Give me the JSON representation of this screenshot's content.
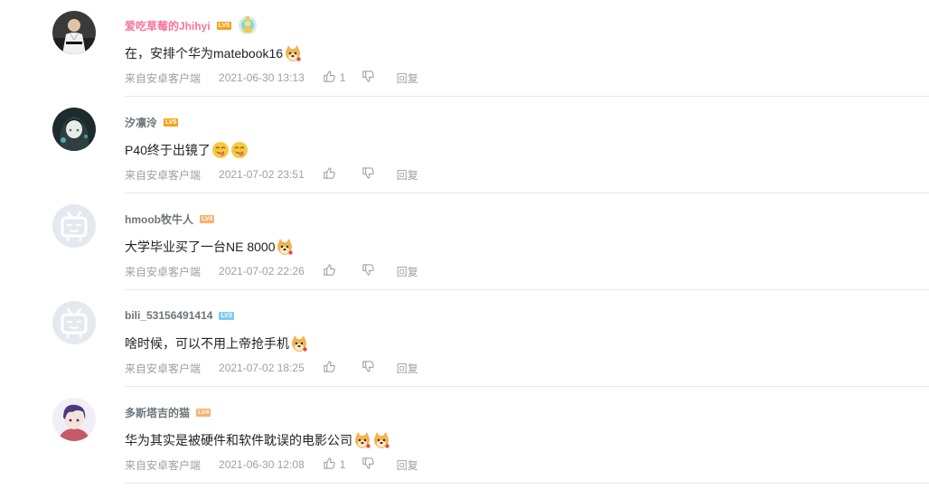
{
  "comments": [
    {
      "username": "爱吃草莓的Jhihyi",
      "level": "LV5",
      "level_color": "#f4a31b",
      "username_color": "#fb7299",
      "has_badge": true,
      "avatar_icon": "karate-avatar-icon",
      "text": "在，安排个华为matebook16",
      "emojis": [
        "doge-icon"
      ],
      "source": "来自安卓客户端",
      "time": "2021-06-30 13:13",
      "like_count": "1",
      "reply_label": "回复"
    },
    {
      "username": "汐凛泠",
      "level": "LV5",
      "level_color": "#f4a31b",
      "username_color": "#6d757a",
      "has_badge": false,
      "avatar_icon": "anime-girl-avatar-icon",
      "text": "P40终于出镜了",
      "emojis": [
        "tongue-face-icon",
        "tongue-face-icon"
      ],
      "source": "来自安卓客户端",
      "time": "2021-07-02 23:51",
      "like_count": "",
      "reply_label": "回复"
    },
    {
      "username": "hmoob牧牛人",
      "level": "LV4",
      "level_color": "#f6b26b",
      "username_color": "#6d757a",
      "has_badge": false,
      "avatar_icon": "default-tv-avatar-icon",
      "text": "大学毕业买了一台NE 8000",
      "emojis": [
        "doge-icon"
      ],
      "source": "来自安卓客户端",
      "time": "2021-07-02 22:26",
      "like_count": "",
      "reply_label": "回复"
    },
    {
      "username": "bili_53156491414",
      "level": "LV3",
      "level_color": "#7bcdef",
      "username_color": "#6d757a",
      "has_badge": false,
      "avatar_icon": "default-tv-avatar-icon",
      "text": "啥时候，可以不用上帝抢手机",
      "emojis": [
        "doge-icon"
      ],
      "source": "来自安卓客户端",
      "time": "2021-07-02 18:25",
      "like_count": "",
      "reply_label": "回复"
    },
    {
      "username": "多斯塔吉的猫",
      "level": "LV4",
      "level_color": "#f6b26b",
      "username_color": "#6d757a",
      "has_badge": false,
      "avatar_icon": "anime-boy-avatar-icon",
      "text": "华为其实是被硬件和软件耽误的电影公司",
      "emojis": [
        "doge-icon",
        "doge-icon"
      ],
      "source": "来自安卓客户端",
      "time": "2021-06-30 12:08",
      "like_count": "1",
      "reply_label": "回复"
    }
  ]
}
